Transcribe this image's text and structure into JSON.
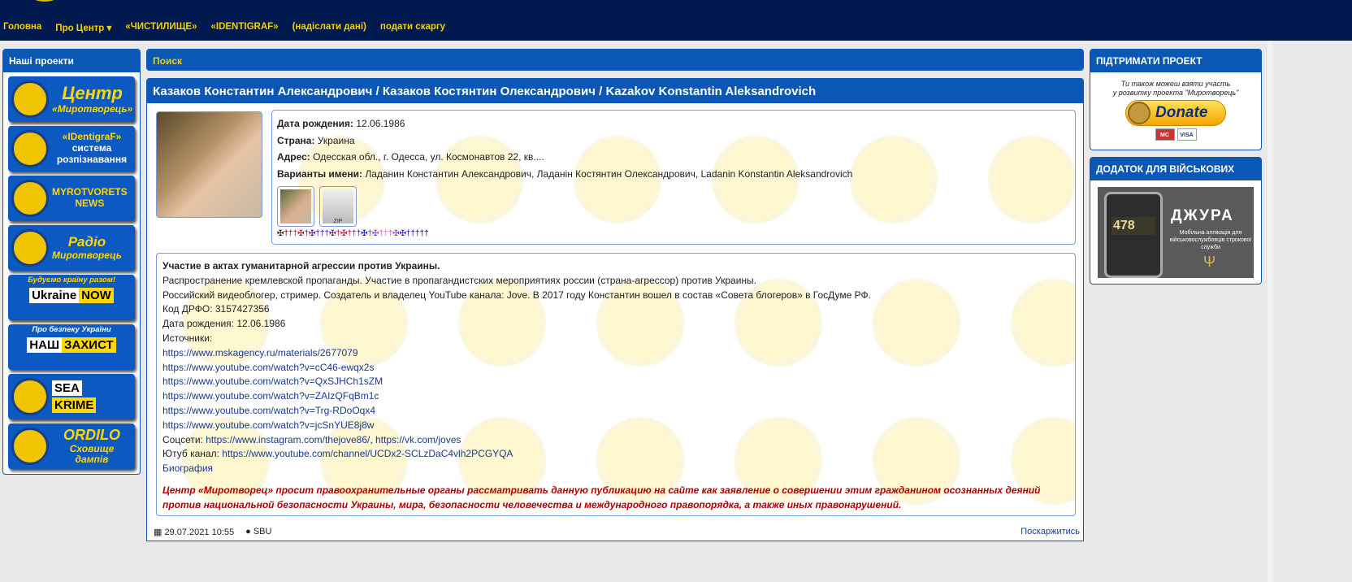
{
  "nav": {
    "items": [
      "Головна",
      "Про Центр ▾",
      "«ЧИСТИЛИЩЕ»",
      "«IDENTIGRAF»",
      "(надіслати дані)",
      "подати скаргу"
    ]
  },
  "left": {
    "title": "Наші проекти",
    "banners": [
      {
        "l1": "Центр",
        "l2": "«Миротворець»"
      },
      {
        "l1": "«IDentigraF»",
        "l2": "система розпізнавання"
      },
      {
        "l1": "MYROTVORETS",
        "l2": "NEWS"
      },
      {
        "l1": "Радіо",
        "l2": "Миротворець"
      },
      {
        "l1": "Будуємо країну разом!",
        "l2": "Ukraine",
        "l3": "NOW",
        "badge": "ua"
      },
      {
        "l1": "Про безпеку України",
        "l2": "НАШ",
        "l3": "ЗАХИСТ",
        "badge": "ua"
      },
      {
        "l1": "SEA",
        "l2": "KRIME"
      },
      {
        "l1": "ORDILO",
        "l2": "Сховище дампів"
      }
    ]
  },
  "search": {
    "label": "Поиск"
  },
  "person": {
    "title": "Казаков Константин Александрович / Казаков Костянтин Олександрович / Kazakov Konstantin Aleksandrovich",
    "dob_label": "Дата рождения:",
    "dob": "12.06.1986",
    "country_label": "Страна:",
    "country": "Украина",
    "address_label": "Адрес:",
    "address": "Одесская обл., г. Одесса, ул. Космонавтов 22, кв....",
    "names_label": "Варианты имени:",
    "names": "Ладанин Константин Александрович, Ладанін Костянтин Олександрович, Ladanin Konstantin Aleksandrovich",
    "zip_label": "ZIP",
    "crosses": "✠†††✠†✠†††✠†✠†††✠†✠†††✠✠†††††"
  },
  "desc": {
    "heading": "Участие в актах гуманитарной агрессии против Украины.",
    "lines": [
      "Распространение кремлевской пропаганды.  Участие в пропагандистских мероприятиях россии (страна-агрессор) против Украины.",
      "Российский видеоблогер, стример. Создатель и владелец YouTube канала: Jove. В 2017 году Константин вошел в состав «Совета блогеров» в ГосДуме РФ.",
      "Код ДРФО: 3157427356",
      "Дата рождения: 12.06.1986",
      "Источники:"
    ],
    "links": [
      "https://www.mskagency.ru/materials/2677079",
      "https://www.youtube.com/watch?v=cC46-ewqx2s",
      "https://www.youtube.com/watch?v=QxSJHCh1sZM",
      "https://www.youtube.com/watch?v=ZAIzQFqBm1c",
      "https://www.youtube.com/watch?v=Trg-RDoOqx4",
      "https://www.youtube.com/watch?v=jcSnYUE8j8w"
    ],
    "social_label": "Соцсети: ",
    "social1": "https://www.instagram.com/thejove86/",
    "social2": "https://vk.com/joves",
    "yt_label": "Ютуб канал: ",
    "yt": "https://www.youtube.com/channel/UCDx2-SCLzDaC4vlh2PCGYQA",
    "bio": "Биография",
    "warning": "Центр «Миротворец» просит правоохранительные органы рассматривать данную публикацию на сайте как заявление о совершении этим гражданином осознанных деяний против национальной безопасности Украины, мира, безопасности человечества и международного правопорядка, а также иных правонарушений."
  },
  "footer": {
    "date": "29.07.2021 10:55",
    "author": "SBU",
    "complain": "Поскаржитись"
  },
  "support": {
    "title": "ПІДТРИМАТИ ПРОЕКТ",
    "text1": "Ти також можеш взяти участь",
    "text2": "у розвитку проекта \"Миротворець\"",
    "donate": "Donate",
    "card1": "MC",
    "card2": "VISA"
  },
  "military": {
    "title": "ДОДАТОК ДЛЯ ВІЙСЬКОВИХ",
    "app_name": "ДЖУРА",
    "app_desc": "Мобільна аплікація для військовослужбовців строкової служби",
    "counter": "478"
  }
}
